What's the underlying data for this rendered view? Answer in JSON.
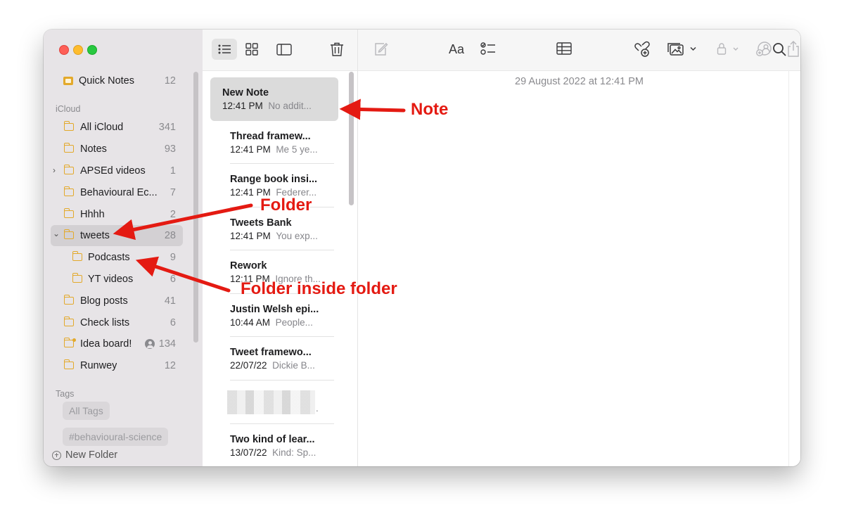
{
  "sidebar": {
    "quick_notes": {
      "label": "Quick Notes",
      "count": "12"
    },
    "icloud_header": "iCloud",
    "folders": [
      {
        "label": "All iCloud",
        "count": "341"
      },
      {
        "label": "Notes",
        "count": "93"
      },
      {
        "label": "APSEd videos",
        "count": "1"
      },
      {
        "label": "Behavioural Ec...",
        "count": "7"
      },
      {
        "label": "Hhhh",
        "count": "2"
      },
      {
        "label": "tweets",
        "count": "28"
      },
      {
        "label": "Podcasts",
        "count": "9"
      },
      {
        "label": "YT videos",
        "count": "6"
      },
      {
        "label": "Blog posts",
        "count": "41"
      },
      {
        "label": "Check lists",
        "count": "6"
      },
      {
        "label": "Idea board!",
        "count": "134"
      },
      {
        "label": "Runwey",
        "count": "12"
      }
    ],
    "tags_header": "Tags",
    "tags": [
      "All Tags",
      "#behavioural-science"
    ],
    "new_folder": "New Folder"
  },
  "list_toolbar": {
    "icons": [
      "list-view-icon",
      "gallery-view-icon",
      "sidebar-toggle-icon",
      "trash-icon"
    ]
  },
  "notes": [
    {
      "title": "New Note",
      "time": "12:41 PM",
      "preview": "No addit..."
    },
    {
      "title": "Thread framew...",
      "time": "12:41 PM",
      "preview": "Me 5 ye..."
    },
    {
      "title": "Range book insi...",
      "time": "12:41 PM",
      "preview": "Federer..."
    },
    {
      "title": "Tweets Bank",
      "time": "12:41 PM",
      "preview": "You exp..."
    },
    {
      "title": "Rework",
      "time": "12:11 PM",
      "preview": "Ignore th..."
    },
    {
      "title": "Justin Welsh epi...",
      "time": "10:44 AM",
      "preview": "People..."
    },
    {
      "title": "Tweet framewo...",
      "time": "22/07/22",
      "preview": "Dickie B..."
    },
    {
      "title": "",
      "time": "",
      "preview": "."
    },
    {
      "title": "Two kind of lear...",
      "time": "13/07/22",
      "preview": "Kind: Sp..."
    }
  ],
  "editor": {
    "date": "29 August 2022 at 12:41 PM",
    "toolbar_icons": [
      "compose-icon",
      "format-text-icon",
      "checklist-icon",
      "table-icon",
      "collaborate-icon",
      "media-icon",
      "lock-icon",
      "share-people-icon",
      "share-icon",
      "search-icon"
    ],
    "format_label": "Aa"
  },
  "annotations": {
    "note": "Note",
    "folder": "Folder",
    "folder_inside": "Folder inside folder"
  },
  "colors": {
    "accent_folder": "#e3a92b",
    "annotation_red": "#e41a12",
    "sidebar_bg": "#e7e4e7"
  }
}
